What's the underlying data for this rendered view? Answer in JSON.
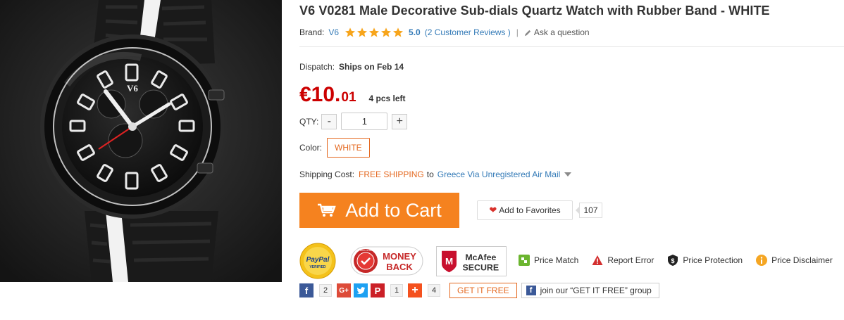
{
  "product": {
    "image_alt": "black V6 quartz watch with white-striped rubber band",
    "title": "V6 V0281 Male Decorative Sub-dials Quartz Watch with Rubber Band  -  WHITE",
    "watch_logo": "V6"
  },
  "brand": {
    "label": "Brand:",
    "name": "V6",
    "rating": "5.0",
    "stars": 5,
    "reviews": "(2 Customer Reviews )",
    "separator": "|",
    "ask": "Ask a question"
  },
  "dispatch": {
    "label": "Dispatch:",
    "value": "Ships on Feb 14"
  },
  "price": {
    "main": "€10.",
    "cents": "01",
    "stock": "4 pcs left"
  },
  "quantity": {
    "label": "QTY:",
    "minus": "-",
    "value": "1",
    "plus": "+"
  },
  "color": {
    "label": "Color:",
    "selected": "WHITE"
  },
  "shipping": {
    "label": "Shipping Cost:",
    "free": "FREE SHIPPING",
    "to": "to",
    "destination": "Greece Via Unregistered Air Mail"
  },
  "actions": {
    "add_to_cart": "Add to Cart",
    "add_to_favorites": "Add to Favorites",
    "favorites_count": "107"
  },
  "badges": {
    "paypal_line1": "PayPal",
    "paypal_line2": "VERIFIED",
    "money_line1": "MONEY",
    "money_line2": "BACK",
    "money_seal": "MONEY BACK GUARANTEE",
    "mcafee_line1": "McAfee",
    "mcafee_line2": "SECURE"
  },
  "links": {
    "price_match": "Price Match",
    "report_error": "Report Error",
    "price_protection": "Price Protection",
    "price_disclaimer": "Price Disclaimer"
  },
  "social": {
    "facebook_count": "2",
    "pinterest_count": "1",
    "plus_count": "4",
    "get_it_free": "GET IT FREE",
    "join_group": "join our “GET IT FREE” group"
  },
  "colors": {
    "accent_orange": "#f5821f",
    "price_red": "#cc0000",
    "link_blue": "#337ab7",
    "star_gold": "#f7a51c"
  }
}
